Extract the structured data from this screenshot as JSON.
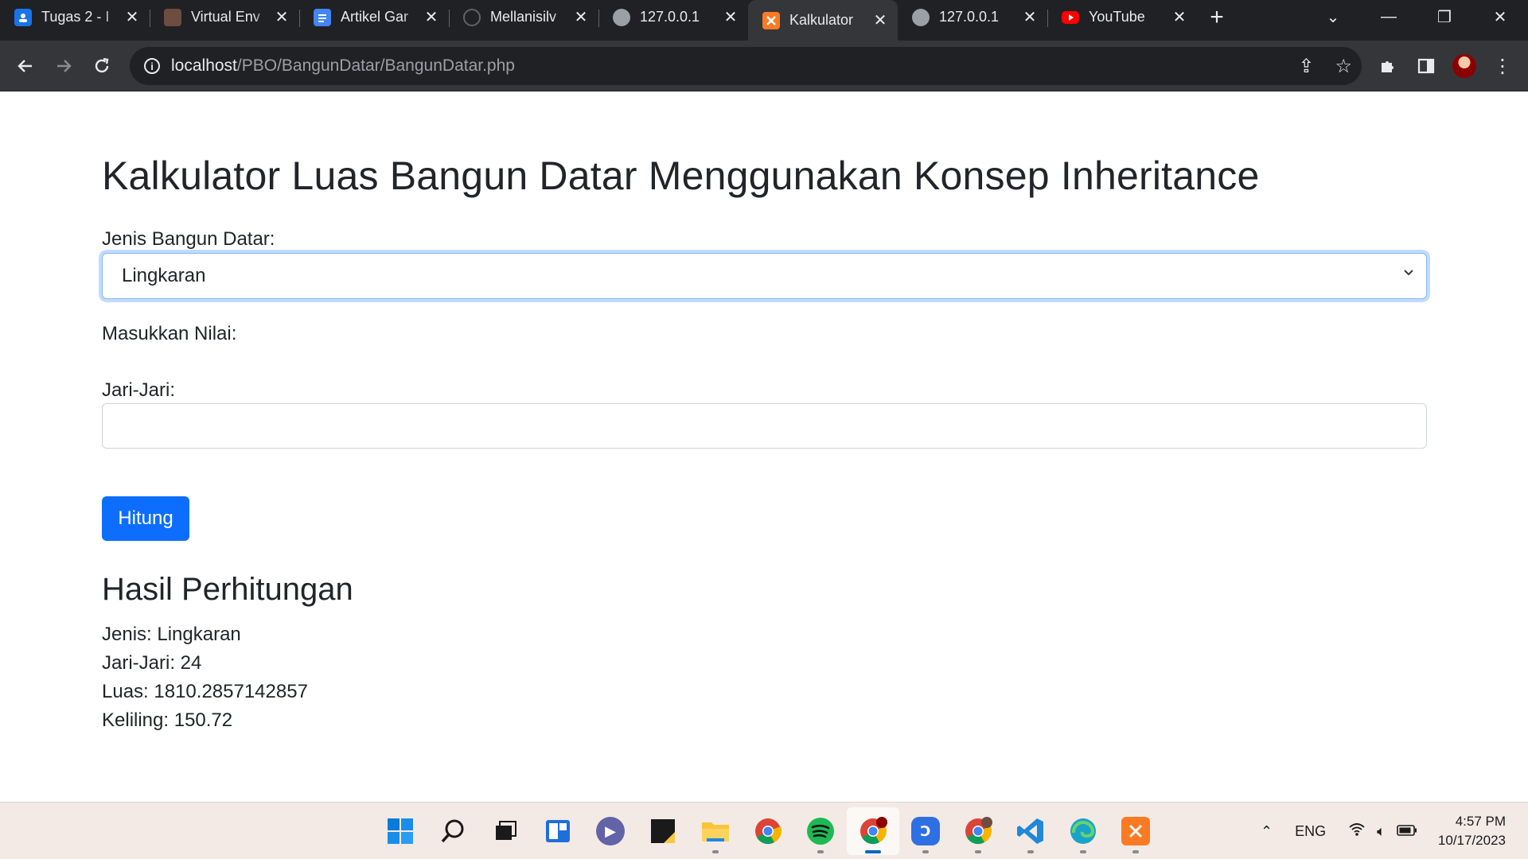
{
  "browser": {
    "tabs": [
      {
        "title": "Tugas 2 - I",
        "favicon": "classroom-icon",
        "color": "#1a73e8",
        "active": false
      },
      {
        "title": "Virtual Env",
        "favicon": "profile-picture-icon",
        "color": "#6d4c41",
        "active": false
      },
      {
        "title": "Artikel Gar",
        "favicon": "google-docs-icon",
        "color": "#4285f4",
        "active": false
      },
      {
        "title": "Mellanisilv",
        "favicon": "github-icon",
        "color": "#202124",
        "active": false
      },
      {
        "title": "127.0.0.1",
        "favicon": "globe-icon",
        "color": "#5f6368",
        "active": false
      },
      {
        "title": "Kalkulator",
        "favicon": "xampp-icon",
        "color": "#fb7a24",
        "active": true
      },
      {
        "title": "127.0.0.1",
        "favicon": "globe-icon",
        "color": "#5f6368",
        "active": false
      },
      {
        "title": "YouTube",
        "favicon": "youtube-icon",
        "color": "#ff0000",
        "active": false
      }
    ],
    "url_host": "localhost",
    "url_path": "/PBO/BangunDatar/BangunDatar.php"
  },
  "page": {
    "title": "Kalkulator Luas Bangun Datar Menggunakan Konsep Inheritance",
    "shape_label": "Jenis Bangun Datar:",
    "shape_selected": "Lingkaran",
    "value_label": "Masukkan Nilai:",
    "radius_label": "Jari-Jari:",
    "radius_value": "",
    "submit_label": "Hitung",
    "result_title": "Hasil Perhitungan",
    "result_lines": [
      "Jenis: Lingkaran",
      "Jari-Jari: 24",
      "Luas: 1810.2857142857",
      "Keliling: 150.72"
    ]
  },
  "taskbar": {
    "apps": [
      {
        "name": "windows-start-icon",
        "active": false
      },
      {
        "name": "search-icon",
        "active": false
      },
      {
        "name": "task-view-icon",
        "active": false
      },
      {
        "name": "widgets-icon",
        "active": false
      },
      {
        "name": "teams-chat-icon",
        "active": false
      },
      {
        "name": "sticky-notes-icon",
        "active": false
      },
      {
        "name": "file-explorer-icon",
        "active": false
      },
      {
        "name": "chrome-icon",
        "active": false
      },
      {
        "name": "spotify-icon",
        "active": false
      },
      {
        "name": "chrome-profile-icon",
        "active": true
      },
      {
        "name": "app-icon",
        "active": false
      },
      {
        "name": "chrome-profile-p-icon",
        "active": false
      },
      {
        "name": "vscode-icon",
        "active": false
      },
      {
        "name": "edge-icon",
        "active": false
      },
      {
        "name": "xampp-icon",
        "active": false
      }
    ],
    "language": "ENG",
    "time": "4:57 PM",
    "date": "10/17/2023"
  }
}
